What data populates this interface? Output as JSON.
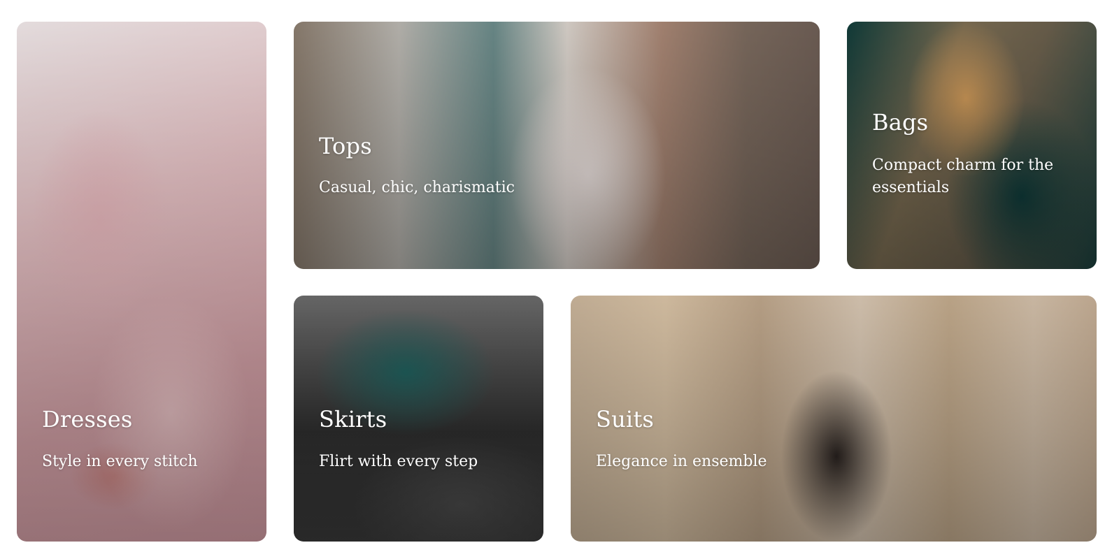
{
  "categories": [
    {
      "id": "dresses",
      "title": "Dresses",
      "subtitle": "Style in every stitch"
    },
    {
      "id": "tops",
      "title": "Tops",
      "subtitle": "Casual, chic, charismatic"
    },
    {
      "id": "bags",
      "title": "Bags",
      "subtitle": "Compact charm for the essentials"
    },
    {
      "id": "skirts",
      "title": "Skirts",
      "subtitle": "Flirt with every step"
    },
    {
      "id": "suits",
      "title": "Suits",
      "subtitle": "Elegance in ensemble"
    }
  ]
}
